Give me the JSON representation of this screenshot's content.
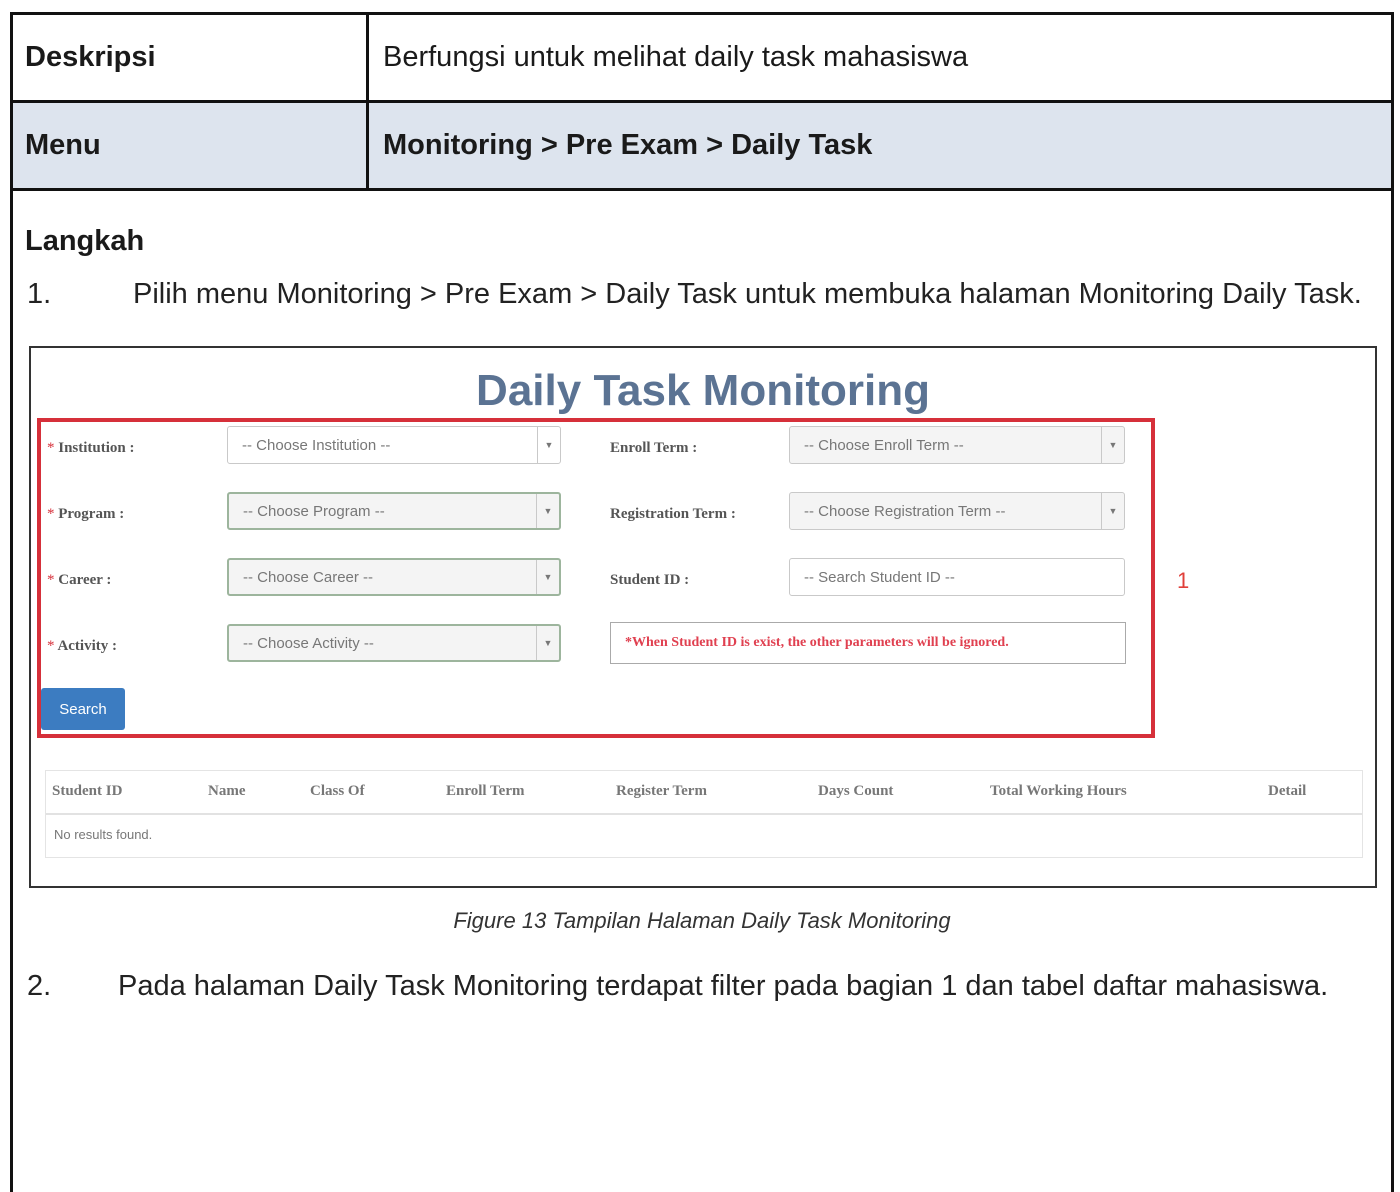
{
  "table": {
    "deskripsi_label": "Deskripsi",
    "deskripsi_value": "Berfungsi untuk melihat daily task mahasiswa",
    "menu_label": "Menu",
    "menu_value": "Monitoring > Pre Exam > Daily Task"
  },
  "section_title": "Langkah",
  "steps": [
    {
      "num": "1.",
      "text": "Pilih menu Monitoring > Pre Exam > Daily Task untuk membuka halaman Monitoring Daily Task."
    },
    {
      "num": "2.",
      "text": "Pada halaman Daily Task Monitoring terdapat filter pada bagian 1 dan tabel daftar mahasiswa."
    }
  ],
  "screenshot": {
    "title": "Daily Task Monitoring",
    "required_mark": "*",
    "fields": {
      "institution": {
        "label": "Institution :",
        "placeholder": "-- Choose Institution --"
      },
      "program": {
        "label": "Program :",
        "placeholder": "-- Choose Program --"
      },
      "career": {
        "label": "Career :",
        "placeholder": "-- Choose Career --"
      },
      "activity": {
        "label": "Activity :",
        "placeholder": "-- Choose Activity --"
      },
      "enroll_term": {
        "label": "Enroll Term :",
        "placeholder": "-- Choose Enroll Term --"
      },
      "registration_term": {
        "label": "Registration Term :",
        "placeholder": "-- Choose Registration Term --"
      },
      "student_id": {
        "label": "Student ID :",
        "placeholder": "-- Search Student ID --"
      }
    },
    "note": "*When Student ID is exist, the other parameters will be ignored.",
    "section_marker": "1",
    "search_label": "Search",
    "columns": [
      "Student ID",
      "Name",
      "Class Of",
      "Enroll Term",
      "Register Term",
      "Days Count",
      "Total Working Hours",
      "Detail"
    ],
    "empty_message": "No results found."
  },
  "caption": "Figure 13 Tampilan Halaman Daily Task Monitoring"
}
